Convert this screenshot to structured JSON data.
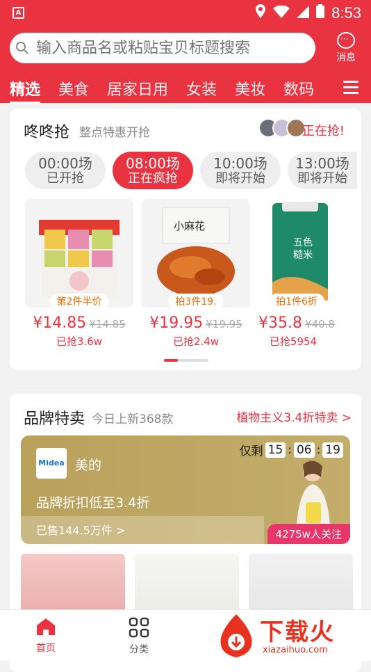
{
  "statusbar": {
    "time": "8:53",
    "app_icon_letter": "A"
  },
  "search": {
    "placeholder": "输入商品名或粘贴宝贝标题搜索"
  },
  "message": {
    "label": "消息"
  },
  "tabs": [
    "精选",
    "美食",
    "居家日用",
    "女装",
    "美妆",
    "数码"
  ],
  "flash": {
    "title": "咚咚抢",
    "subtitle": "整点特惠开抢",
    "status": "正在抢!",
    "slots": [
      {
        "time": "00:00场",
        "state": "已开抢"
      },
      {
        "time": "08:00场",
        "state": "正在疯抢"
      },
      {
        "time": "10:00场",
        "state": "即将开始"
      },
      {
        "time": "13:00场",
        "state": "即将开始"
      }
    ],
    "products": [
      {
        "tag": "第2件半价",
        "price": "¥14.85",
        "orig": "¥14.85",
        "sold": "已抢3.6w"
      },
      {
        "tag": "拍3件19.",
        "price": "¥19.95",
        "orig": "¥19.95",
        "sold": "已抢2.4w",
        "img_text": "小麻花"
      },
      {
        "tag": "拍1件6折",
        "price": "¥35.8",
        "orig": "¥40.8",
        "sold": "已抢5954",
        "img_text": "五色糙米"
      }
    ]
  },
  "brand": {
    "title": "品牌特卖",
    "subtitle": "今日上新368款",
    "link": "植物主义3.4折特卖 >",
    "banner": {
      "logo": "Midea",
      "name": "美的",
      "discount": "品牌折扣低至3.4折",
      "sold": "已售144.5万件 >",
      "remain_label": "仅剩",
      "hh": "15",
      "mm": "06",
      "ss": "19",
      "follow": "4275w人关注"
    }
  },
  "nav": {
    "home": "首页",
    "category": "分类"
  },
  "watermark": {
    "text": "下载火",
    "url": "xiazaihuo.com"
  },
  "colors": {
    "primary": "#ea3341",
    "gold": "#bca360",
    "follow": "#e8356a"
  }
}
